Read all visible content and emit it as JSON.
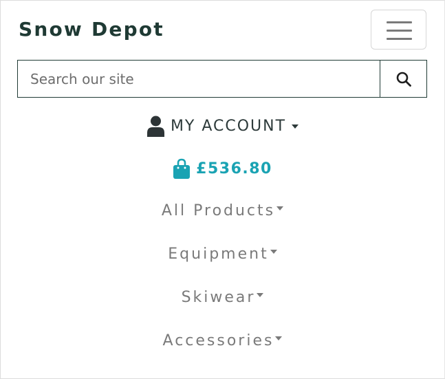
{
  "brand": {
    "name": "Snow Depot"
  },
  "search": {
    "placeholder": "Search our site"
  },
  "account": {
    "label": "MY ACCOUNT"
  },
  "bag": {
    "total": "£536.80"
  },
  "menu": {
    "items": [
      {
        "label": "All Products"
      },
      {
        "label": "Equipment"
      },
      {
        "label": "Skiwear"
      },
      {
        "label": "Accessories"
      }
    ]
  },
  "colors": {
    "brand": "#1f3a34",
    "accent": "#1aa3b3",
    "nav": "#7a7a7a"
  },
  "icons": {
    "toggle": "hamburger-icon",
    "search": "search-icon",
    "account": "user-icon",
    "bag": "shopping-bag-icon"
  }
}
